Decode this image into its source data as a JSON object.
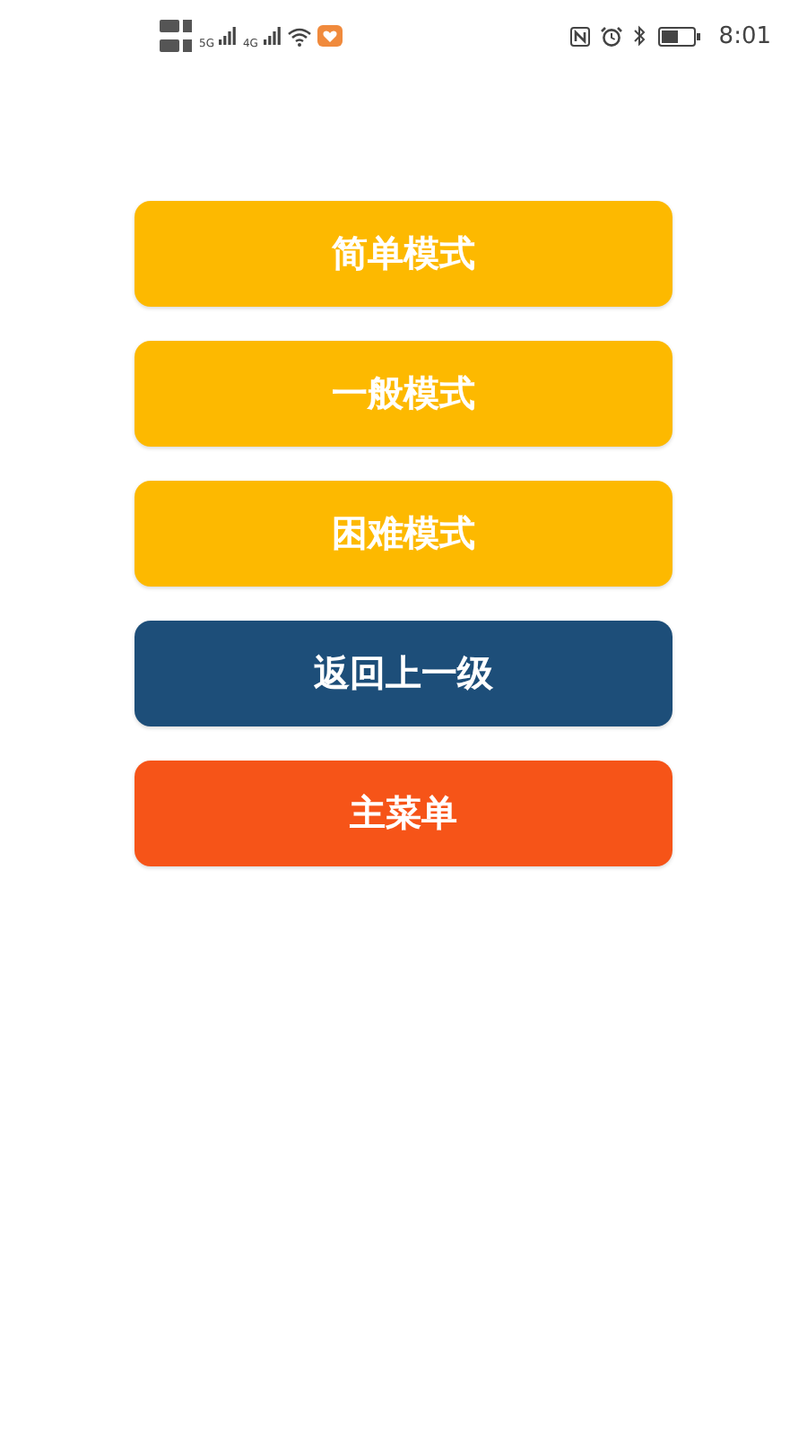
{
  "status_bar": {
    "network_1": "5G",
    "network_2": "4G",
    "time": "8:01"
  },
  "buttons": [
    {
      "label": "简单模式",
      "color": "#fdb900"
    },
    {
      "label": "一般模式",
      "color": "#fdb900"
    },
    {
      "label": "困难模式",
      "color": "#fdb900"
    },
    {
      "label": "返回上一级",
      "color": "#1d4e79"
    },
    {
      "label": "主菜单",
      "color": "#f65418"
    }
  ]
}
